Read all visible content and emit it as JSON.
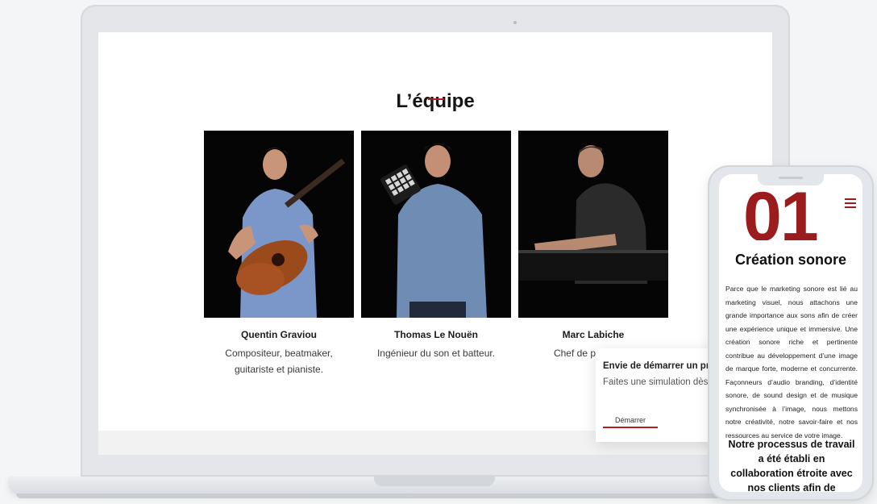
{
  "team": {
    "title": "L’équipe",
    "members": [
      {
        "name": "Quentin Graviou",
        "role": "Compositeur, beatmaker, guitariste et pianiste."
      },
      {
        "name": "Thomas Le Nouën",
        "role": "Ingénieur du son et batteur."
      },
      {
        "name": "Marc Labiche",
        "role": "Chef de projet, pia"
      }
    ]
  },
  "popup": {
    "title": "Envie de démarrer un pro",
    "subtitle": "Faites une simulation dès",
    "button": "Démarrer"
  },
  "mobile": {
    "number": "01",
    "title": "Création sonore",
    "body": "Parce que le marketing sonore est lié au marketing visuel, nous attachons une grande importance aux sons afin de créer une expérience unique et immersive. Une création sonore riche et pertinente contribue au développement d’une image de marque forte, moderne et concurrente. Façonneurs d’audio branding, d’identité sonore, de sound design et de musique synchronisée à l’image, nous mettons notre créativité, notre savoir-faire et nos ressources au service de votre image.",
    "lead": "Notre processus de travail a été établi en collaboration étroite avec nos clients afin de conserver un dialogue"
  },
  "colors": {
    "accent": "#b11e22",
    "background": "#f4f5f7"
  }
}
